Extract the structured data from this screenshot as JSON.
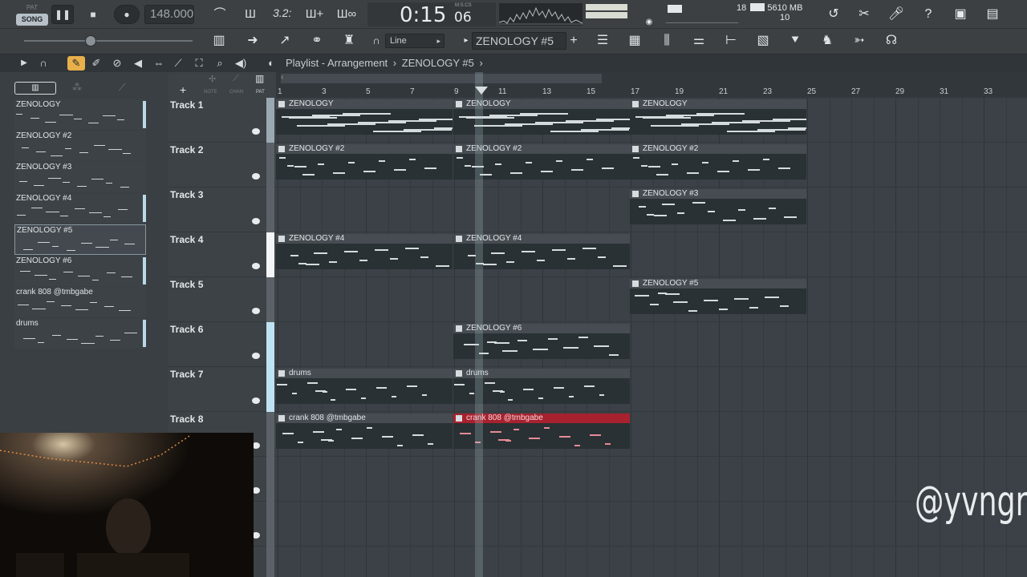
{
  "transport": {
    "mode_pat": "PAT",
    "mode_song": "SONG",
    "tempo": "148.000",
    "time_sig": "3.2:",
    "time": "0:15",
    "time_sub": "06",
    "time_format": "M:S:CS",
    "cpu_top": "18",
    "memory": "5610 MB",
    "cpu_bottom": "10"
  },
  "toolbar": {
    "snap_label": "Line",
    "pattern_selector": "ZENOLOGY #5",
    "add_label": "+"
  },
  "playlist_header": {
    "title": "Playlist - Arrangement",
    "separator": "›",
    "pattern": "ZENOLOGY #5",
    "add_label": "+",
    "note_label": "NOTE",
    "chan_label": "CHAN",
    "pat_label": "PAT"
  },
  "patterns": [
    "ZENOLOGY",
    "ZENOLOGY #2",
    "ZENOLOGY #3",
    "ZENOLOGY #4",
    "ZENOLOGY #5",
    "ZENOLOGY #6",
    "crank 808 @tmbgabe",
    "drums"
  ],
  "tracks": [
    "Track 1",
    "Track 2",
    "Track 3",
    "Track 4",
    "Track 5",
    "Track 6",
    "Track 7",
    "Track 8"
  ],
  "ruler": [
    "1",
    "3",
    "5",
    "7",
    "9",
    "11",
    "13",
    "15",
    "17",
    "19",
    "21",
    "23",
    "25",
    "27",
    "29",
    "31",
    "33"
  ],
  "clips": [
    {
      "track": 1,
      "label": "ZENOLOGY"
    },
    {
      "track": 1,
      "label": "ZENOLOGY"
    },
    {
      "track": 1,
      "label": "ZENOLOGY"
    },
    {
      "track": 2,
      "label": "ZENOLOGY #2"
    },
    {
      "track": 2,
      "label": "ZENOLOGY #2"
    },
    {
      "track": 2,
      "label": "ZENOLOGY #2"
    },
    {
      "track": 3,
      "label": "ZENOLOGY #3"
    },
    {
      "track": 4,
      "label": "ZENOLOGY #4"
    },
    {
      "track": 4,
      "label": "ZENOLOGY #4"
    },
    {
      "track": 5,
      "label": "ZENOLOGY #5"
    },
    {
      "track": 6,
      "label": "ZENOLOGY #6"
    },
    {
      "track": 7,
      "label": "drums"
    },
    {
      "track": 7,
      "label": "drums"
    },
    {
      "track": 8,
      "label": "crank 808 @tmbgabe"
    },
    {
      "track": 8,
      "label": "crank 808 @tmbgabe"
    }
  ],
  "watermark": "@yvngrobv",
  "colors": {
    "selected_clip": "#a8212e",
    "background": "#3b4146"
  }
}
